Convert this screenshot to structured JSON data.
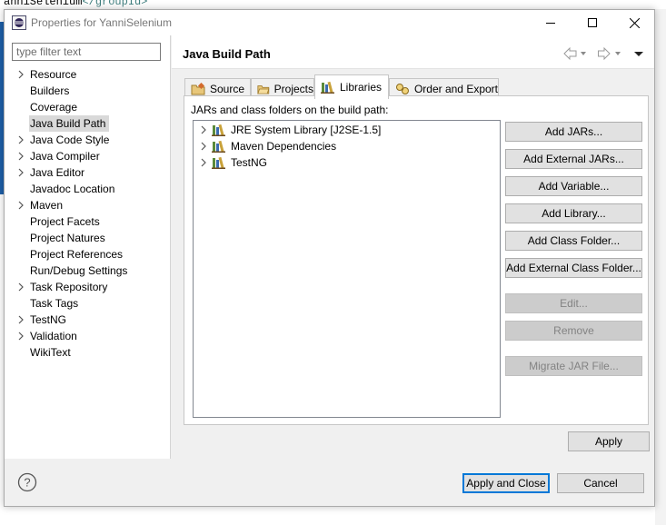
{
  "background": {
    "code_text": "anniSelenium",
    "code_tag": "</groupId>"
  },
  "window": {
    "title": "Properties for YanniSelenium",
    "icons": {
      "app": "eclipse-icon",
      "minimize": "minimize-icon",
      "maximize": "maximize-icon",
      "close": "close-icon"
    }
  },
  "sidebar": {
    "filter_placeholder": "type filter text",
    "items": [
      {
        "label": "Resource",
        "expandable": true
      },
      {
        "label": "Builders",
        "expandable": false
      },
      {
        "label": "Coverage",
        "expandable": false
      },
      {
        "label": "Java Build Path",
        "expandable": false,
        "selected": true
      },
      {
        "label": "Java Code Style",
        "expandable": true
      },
      {
        "label": "Java Compiler",
        "expandable": true
      },
      {
        "label": "Java Editor",
        "expandable": true
      },
      {
        "label": "Javadoc Location",
        "expandable": false
      },
      {
        "label": "Maven",
        "expandable": true
      },
      {
        "label": "Project Facets",
        "expandable": false
      },
      {
        "label": "Project Natures",
        "expandable": false
      },
      {
        "label": "Project References",
        "expandable": false
      },
      {
        "label": "Run/Debug Settings",
        "expandable": false
      },
      {
        "label": "Task Repository",
        "expandable": true
      },
      {
        "label": "Task Tags",
        "expandable": false
      },
      {
        "label": "TestNG",
        "expandable": true
      },
      {
        "label": "Validation",
        "expandable": true
      },
      {
        "label": "WikiText",
        "expandable": false
      }
    ]
  },
  "page": {
    "title": "Java Build Path",
    "nav_icons": [
      "back-arrow-icon",
      "forward-arrow-icon",
      "view-menu-icon"
    ]
  },
  "tabs": [
    {
      "label": "Source",
      "icon": "source-folder-icon",
      "active": false
    },
    {
      "label": "Projects",
      "icon": "project-folder-icon",
      "active": false
    },
    {
      "label": "Libraries",
      "icon": "library-icon",
      "active": true
    },
    {
      "label": "Order and Export",
      "icon": "order-export-icon",
      "active": false
    }
  ],
  "libraries": {
    "description": "JARs and class folders on the build path:",
    "items": [
      {
        "label": "JRE System Library [J2SE-1.5]",
        "icon": "library-icon"
      },
      {
        "label": "Maven Dependencies",
        "icon": "library-icon"
      },
      {
        "label": "TestNG",
        "icon": "library-icon"
      }
    ]
  },
  "actions": {
    "add_jars": "Add JARs...",
    "add_external_jars": "Add External JARs...",
    "add_variable": "Add Variable...",
    "add_library": "Add Library...",
    "add_class_folder": "Add Class Folder...",
    "add_external_class_folder": "Add External Class Folder...",
    "edit": "Edit...",
    "remove": "Remove",
    "migrate_jar": "Migrate JAR File..."
  },
  "apply": "Apply",
  "footer": {
    "help_icon": "help-icon",
    "apply_and_close": "Apply and Close",
    "cancel": "Cancel"
  },
  "colors": {
    "dialog_bg": "#f0f0f0",
    "selection": "#d9d9d9",
    "default_button_border": "#0078d7",
    "disabled_text": "#838383"
  }
}
